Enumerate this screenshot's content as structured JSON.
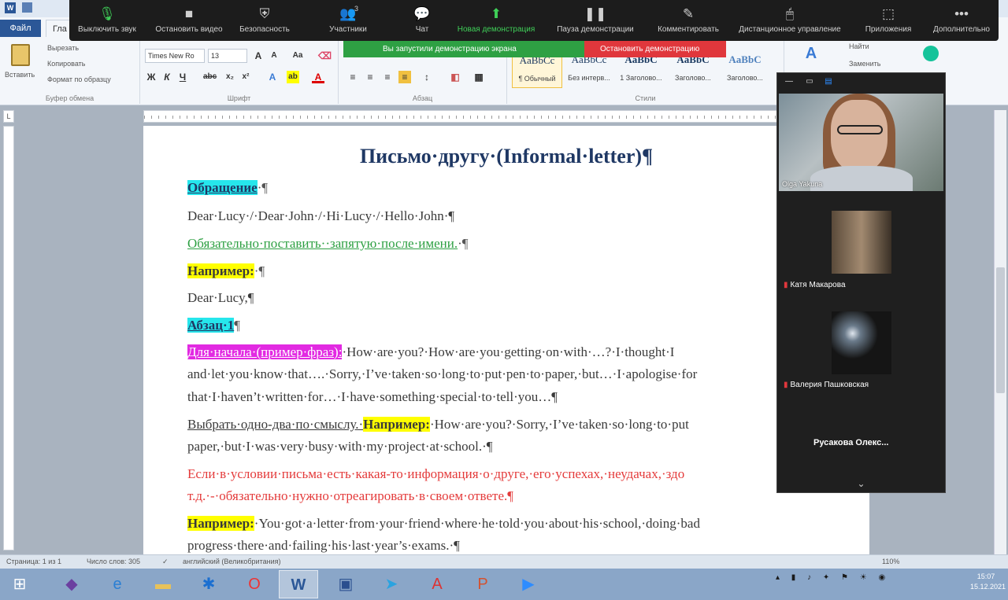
{
  "word": {
    "file_tab": "Файл",
    "home_tab": "Гла",
    "groups": [
      {
        "label": "Буфер обмена"
      },
      {
        "label": "Шрифт"
      },
      {
        "label": "Абзац"
      },
      {
        "label": "Стили"
      }
    ],
    "clipboard": {
      "paste": "Вставить",
      "cut": "Вырезать",
      "copy": "Копировать",
      "format_painter": "Формат по образцу"
    },
    "font": {
      "name": "Times New Ro",
      "size": "13"
    },
    "styles": [
      {
        "preview": "AaBbCc",
        "name": "¶ Обычный"
      },
      {
        "preview": "AaBbCc",
        "name": "Без интерв..."
      },
      {
        "preview": "AaBbC",
        "name": "1 Заголово..."
      },
      {
        "preview": "AaBbC",
        "name": "Заголово..."
      },
      {
        "preview": "AaBbC",
        "name": "Заголово..."
      }
    ],
    "editing": {
      "find": "Найти",
      "replace": "Заменить"
    }
  },
  "zoom": {
    "toolbar": [
      {
        "icon": "microphone-icon",
        "label": "Выключить звук"
      },
      {
        "icon": "video-icon",
        "label": "Остановить видео"
      },
      {
        "icon": "shield-icon",
        "label": "Безопасность"
      },
      {
        "icon": "participants-icon",
        "label": "Участники",
        "count": "3"
      },
      {
        "icon": "chat-icon",
        "label": "Чат"
      },
      {
        "icon": "share-screen-icon",
        "label": "Новая демонстрация"
      },
      {
        "icon": "pause-icon",
        "label": "Пауза демонстрации"
      },
      {
        "icon": "annotate-icon",
        "label": "Комментировать"
      },
      {
        "icon": "remote-control-icon",
        "label": "Дистанционное управление"
      },
      {
        "icon": "apps-icon",
        "label": "Приложения"
      },
      {
        "icon": "more-icon",
        "label": "Дополнительно"
      }
    ],
    "share_message": "Вы запустили демонстрацию экрана",
    "stop_share": "Остановить демонстрацию",
    "participants": [
      {
        "name": "Olga Yakuna"
      },
      {
        "name": "Катя Макарова"
      },
      {
        "name": "Валерия Пашковская"
      },
      {
        "name": "Русакова Олекс..."
      }
    ]
  },
  "document": {
    "title": "Письмо·другу·(Informal·letter)¶",
    "p1_hl": "Обращение",
    "p1_rest": "·¶",
    "p2": "Dear·Lucy·/·Dear·John·/·Hi·Lucy·/·Hello·John·¶",
    "p3_green": "Обязательно·поставить··запятую·после·имени.",
    "p3_rest": "·¶",
    "p4_hl": "Например:",
    "p4_rest": "·¶",
    "p5": "Dear·Lucy,¶",
    "p6_hl": "Абзац·1",
    "p6_rest": "¶",
    "p7_hl": "Для·начала·(пример·фраз):",
    "p7_rest": "·How·are·you?·How·are·you·getting·on·with·…?·I·thought·I",
    "p7b": "and·let·you·know·that….·Sorry,·I’ve·taken·so·long·to·put·pen·to·paper,·but…·I·apologise·for",
    "p7c": "that·I·haven’t·written·for…·I·have·something·special·to·tell·you…¶",
    "p8_a": "Выбрать·одно-два·по·смыслу.·",
    "p8_hl": "Например:",
    "p8_rest": "·How·are·you?·Sorry,·I’ve·taken·so·long·to·put",
    "p8b": "paper,·but·I·was·very·busy·with·my·project·at·school.·¶",
    "p9": "Если·в·условии·письма·есть·какая-то·информация·о·друге,·его·успехах,·неудачах,·здо",
    "p9b": "т.д.·-·обязательно·нужно·отреагировать·в·своем·ответе.¶",
    "p10_hl": "Например:",
    "p10_rest": "·You·got·a·letter·from·your·friend·where·he·told·you·about·his·school,·doing·bad",
    "p10b": "progress·there·and·failing·his·last·year’s·exams.·¶"
  },
  "statusbar": {
    "page": "Страница: 1 из 1",
    "words": "Число слов: 305",
    "language": "английский (Великобритания)",
    "zoom": "110%"
  },
  "taskbar": {
    "time": "15:07",
    "date": "15.12.2021"
  }
}
